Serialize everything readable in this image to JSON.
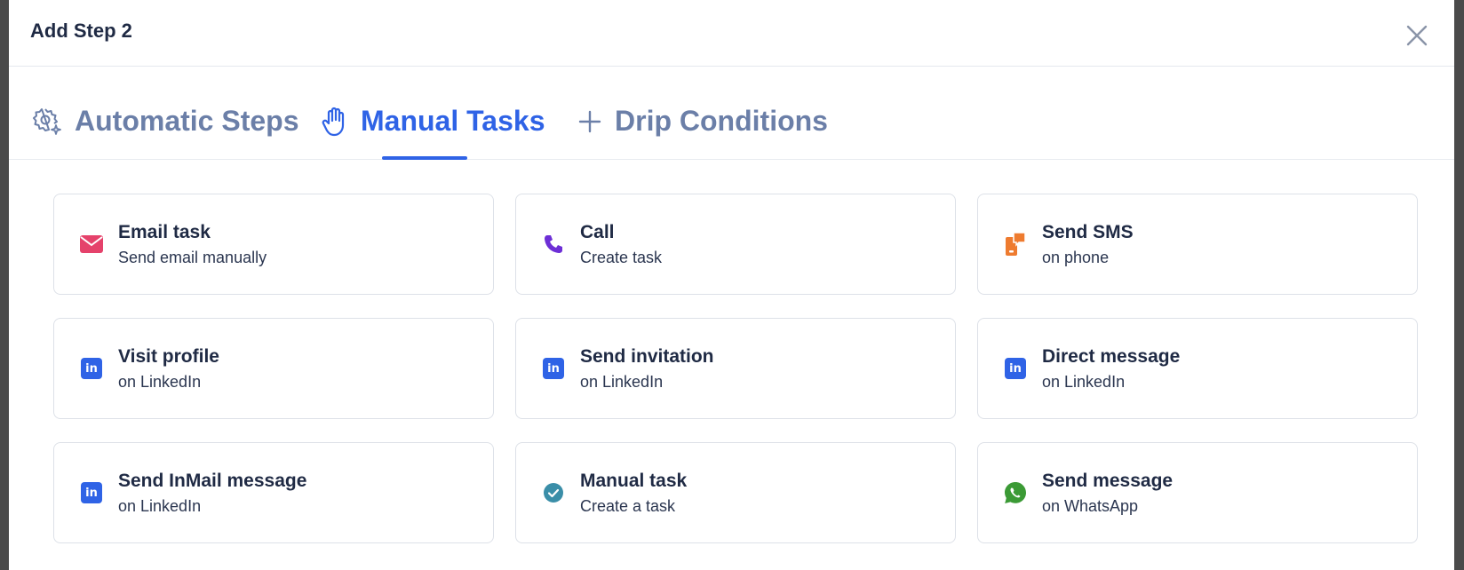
{
  "modal": {
    "title": "Add Step 2"
  },
  "tabs": [
    {
      "label": "Automatic Steps",
      "icon": "gear-sparkle-icon",
      "active": false
    },
    {
      "label": "Manual Tasks",
      "icon": "hand-icon",
      "active": true
    },
    {
      "label": "Drip Conditions",
      "icon": "plus-icon",
      "active": false
    }
  ],
  "cards": [
    {
      "title": "Email task",
      "subtitle": "Send email manually",
      "icon": "email-icon",
      "color": "#e5426b"
    },
    {
      "title": "Call",
      "subtitle": "Create task",
      "icon": "phone-icon",
      "color": "#6d2fd6"
    },
    {
      "title": "Send SMS",
      "subtitle": "on phone",
      "icon": "sms-icon",
      "color": "#ee7b2f"
    },
    {
      "title": "Visit profile",
      "subtitle": "on LinkedIn",
      "icon": "linkedin-icon",
      "color": "#2f63e6"
    },
    {
      "title": "Send invitation",
      "subtitle": "on LinkedIn",
      "icon": "linkedin-icon",
      "color": "#2f63e6"
    },
    {
      "title": "Direct message",
      "subtitle": "on LinkedIn",
      "icon": "linkedin-icon",
      "color": "#2f63e6"
    },
    {
      "title": "Send InMail message",
      "subtitle": "on LinkedIn",
      "icon": "linkedin-icon",
      "color": "#2f63e6"
    },
    {
      "title": "Manual task",
      "subtitle": "Create a task",
      "icon": "check-circle-icon",
      "color": "#3a8ea8"
    },
    {
      "title": "Send message",
      "subtitle": "on WhatsApp",
      "icon": "whatsapp-icon",
      "color": "#3b9a35"
    }
  ],
  "colors": {
    "accent": "#2f63e6",
    "tab_inactive": "#6b7fa8",
    "text": "#1f2a44"
  }
}
